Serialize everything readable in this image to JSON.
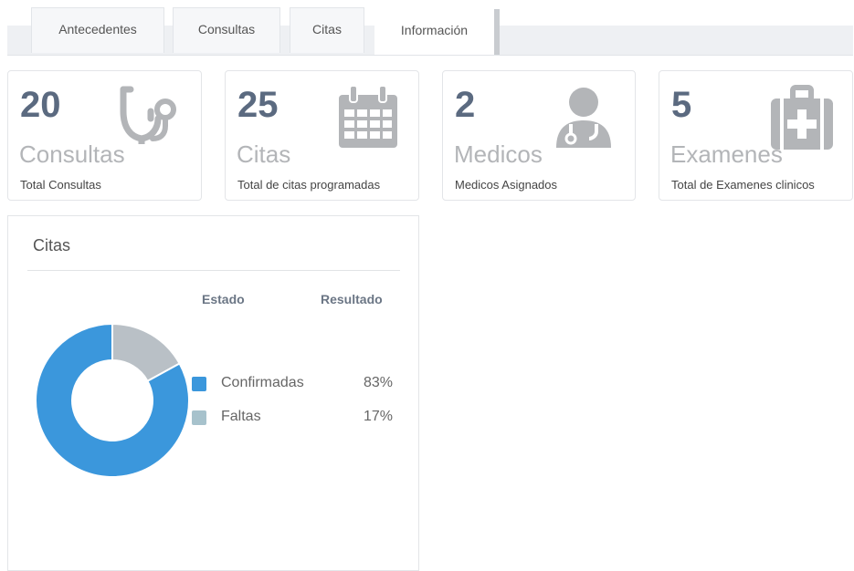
{
  "tabs": [
    {
      "label": "Antecedentes",
      "active": false
    },
    {
      "label": "Consultas",
      "active": false
    },
    {
      "label": "Citas",
      "active": false
    },
    {
      "label": "Información",
      "active": true
    }
  ],
  "stats": [
    {
      "value": "20",
      "word": "Consultas",
      "desc": "Total Consultas",
      "icon": "stethoscope-icon"
    },
    {
      "value": "25",
      "word": "Citas",
      "desc": "Total de citas programadas",
      "icon": "calendar-icon"
    },
    {
      "value": "2",
      "word": "Medicos",
      "desc": "Medicos Asignados",
      "icon": "doctor-icon"
    },
    {
      "value": "5",
      "word": "Examenes",
      "desc": "Total de Examenes clinicos",
      "icon": "medical-kit-icon"
    }
  ],
  "colors": {
    "number": "#5b6a80",
    "icon": "#b3b5b8",
    "confirmadas": "#3b97dc",
    "faltas": "#b9c0c6"
  },
  "panel": {
    "title": "Citas",
    "col_estado": "Estado",
    "col_resultado": "Resultado"
  },
  "chart_data": {
    "type": "pie",
    "donut": true,
    "categories": [
      "Confirmadas",
      "Faltas"
    ],
    "values": [
      83,
      17
    ],
    "value_labels": [
      "83%",
      "17%"
    ],
    "colors": [
      "#3b97dc",
      "#b9c0c6"
    ],
    "legend_swatch_colors": [
      "#3b97dc",
      "#a7c2cc"
    ],
    "legend": "right"
  }
}
